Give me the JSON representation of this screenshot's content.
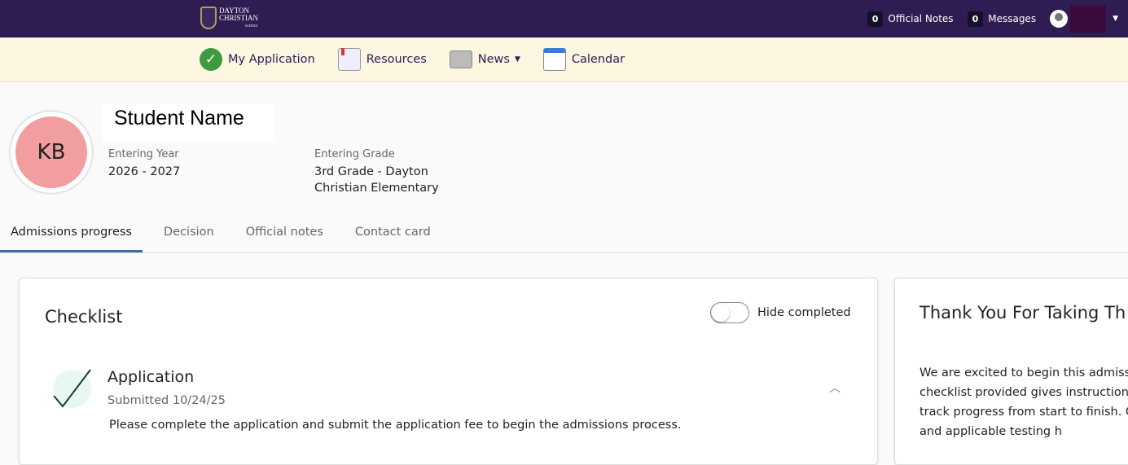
{
  "topbar": {
    "logo_text": "DAYTON CHRISTIAN SCHOOL",
    "logo_line1": "DAYTON",
    "logo_line2": "CHRISTIAN",
    "logo_line3": "SCHOOL",
    "official_notes_count": "0",
    "official_notes_label": "Official Notes",
    "messages_count": "0",
    "messages_label": "Messages"
  },
  "nav": {
    "items": [
      {
        "label": "My Application"
      },
      {
        "label": "Resources"
      },
      {
        "label": "News"
      },
      {
        "label": "Calendar"
      }
    ]
  },
  "student": {
    "initials": "KB",
    "name": "Student Name",
    "entering_year_label": "Entering Year",
    "entering_year": "2026 - 2027",
    "entering_grade_label": "Entering Grade",
    "entering_grade": "3rd Grade - Dayton Christian Elementary"
  },
  "tabs": [
    {
      "label": "Admissions progress"
    },
    {
      "label": "Decision"
    },
    {
      "label": "Official notes"
    },
    {
      "label": "Contact card"
    }
  ],
  "checklist": {
    "title": "Checklist",
    "hide_completed_label": "Hide completed",
    "hide_completed": false,
    "items": [
      {
        "title": "Application",
        "status": "Submitted 10/24/25",
        "description": "Please complete the application and submit the application fee to begin the admissions process."
      }
    ]
  },
  "welcome": {
    "title": "Thank You For Taking Th",
    "body": "We are excited to begin this admiss family. The checklist provided gives instructions and allows you to track progress from start to finish. Once a submitted and applicable testing h"
  }
}
